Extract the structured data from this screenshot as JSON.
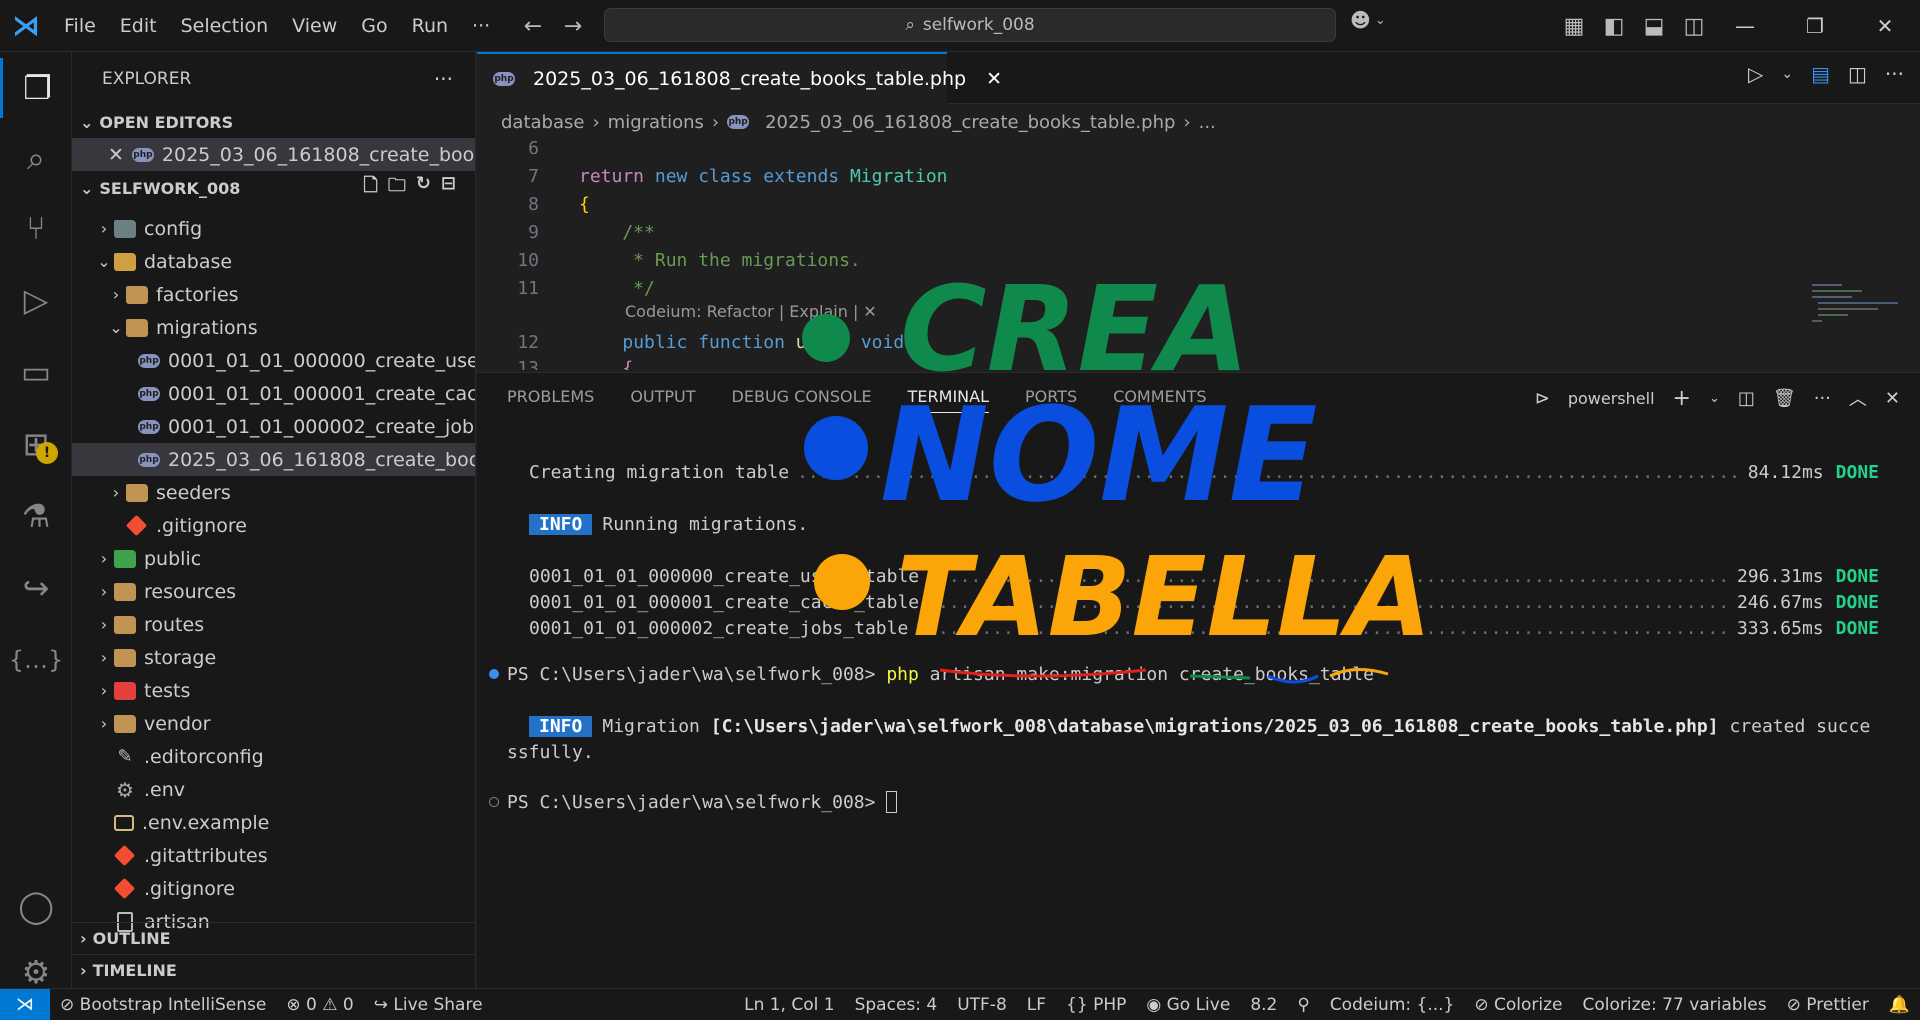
{
  "titlebar": {
    "menus": [
      "File",
      "Edit",
      "Selection",
      "View",
      "Go",
      "Run"
    ],
    "more": "···",
    "search": "selfwork_008"
  },
  "explorer": {
    "header": "EXPLORER",
    "open_editors_label": "OPEN EDITORS",
    "open_editor_file": "2025_03_06_161808_create_books...",
    "project_label": "SELFWORK_008",
    "tree": [
      {
        "label": "config",
        "depth": 1,
        "kind": "folder-config",
        "chev": ">"
      },
      {
        "label": "database",
        "depth": 1,
        "kind": "folder-db",
        "chev": "v"
      },
      {
        "label": "factories",
        "depth": 2,
        "kind": "folder",
        "chev": ">"
      },
      {
        "label": "migrations",
        "depth": 2,
        "kind": "folder",
        "chev": "v"
      },
      {
        "label": "0001_01_01_000000_create_user...",
        "depth": 3,
        "kind": "php",
        "chev": ""
      },
      {
        "label": "0001_01_01_000001_create_cach...",
        "depth": 3,
        "kind": "php",
        "chev": ""
      },
      {
        "label": "0001_01_01_000002_create_jobs...",
        "depth": 3,
        "kind": "php",
        "chev": ""
      },
      {
        "label": "2025_03_06_161808_create_boo...",
        "depth": 3,
        "kind": "php",
        "chev": "",
        "selected": true
      },
      {
        "label": "seeders",
        "depth": 2,
        "kind": "folder",
        "chev": ">"
      },
      {
        "label": ".gitignore",
        "depth": 2,
        "kind": "git",
        "chev": ""
      },
      {
        "label": "public",
        "depth": 1,
        "kind": "folder-green",
        "chev": ">"
      },
      {
        "label": "resources",
        "depth": 1,
        "kind": "folder",
        "chev": ">"
      },
      {
        "label": "routes",
        "depth": 1,
        "kind": "folder",
        "chev": ">"
      },
      {
        "label": "storage",
        "depth": 1,
        "kind": "folder",
        "chev": ">"
      },
      {
        "label": "tests",
        "depth": 1,
        "kind": "folder-red",
        "chev": ">"
      },
      {
        "label": "vendor",
        "depth": 1,
        "kind": "folder",
        "chev": ">"
      },
      {
        "label": ".editorconfig",
        "depth": 1,
        "kind": "editorconfig",
        "chev": ""
      },
      {
        "label": ".env",
        "depth": 1,
        "kind": "gear",
        "chev": ""
      },
      {
        "label": ".env.example",
        "depth": 1,
        "kind": "env",
        "chev": ""
      },
      {
        "label": ".gitattributes",
        "depth": 1,
        "kind": "git",
        "chev": ""
      },
      {
        "label": ".gitignore",
        "depth": 1,
        "kind": "git",
        "chev": ""
      },
      {
        "label": "artisan",
        "depth": 1,
        "kind": "file",
        "chev": ""
      }
    ],
    "outline_label": "OUTLINE",
    "timeline_label": "TIMELINE"
  },
  "editor": {
    "tab_title": "2025_03_06_161808_create_books_table.php",
    "breadcrumb": [
      "database",
      "migrations",
      "2025_03_06_161808_create_books_table.php",
      "..."
    ],
    "codelens": "Codeium: Refactor | Explain | ✕"
  },
  "panel": {
    "tabs": [
      "PROBLEMS",
      "OUTPUT",
      "DEBUG CONSOLE",
      "TERMINAL",
      "PORTS",
      "COMMENTS"
    ],
    "active_tab": "TERMINAL",
    "shell": "powershell",
    "lines": {
      "creating": "Creating migration table",
      "creating_time": "84.12ms",
      "done": "DONE",
      "info": "INFO",
      "running": "Running migrations.",
      "m0": "0001_01_01_000000_create_users_table",
      "m0_time": "296.31ms",
      "m1": "0001_01_01_000001_create_cache_table",
      "m1_time": "246.67ms",
      "m2": "0001_01_01_000002_create_jobs_table",
      "m2_time": "333.65ms",
      "prompt": "PS C:\\Users\\jader\\wa\\selfwork_008>",
      "cmd_php": "php",
      "cmd_rest": "artisan make:migration create_books_table",
      "created_a": "Migration",
      "created_path": "[C:\\Users\\jader\\wa\\selfwork_008\\database\\migrations/2025_03_06_161808_create_books_table.php]",
      "created_b": "created succe",
      "created_c": "ssfully."
    }
  },
  "statusbar": {
    "bootstrap": "Bootstrap IntelliSense",
    "errors": "0",
    "warnings": "0",
    "liveshare": "Live Share",
    "position": "Ln 1, Col 1",
    "spaces": "Spaces: 4",
    "encoding": "UTF-8",
    "eol": "LF",
    "language": "PHP",
    "golive": "Go Live",
    "php_version": "8.2",
    "codeium": "Codeium: {...}",
    "colorize": "Colorize",
    "colorize_vars": "Colorize: 77 variables",
    "prettier": "Prettier"
  },
  "annotations": {
    "word1": "CREA",
    "word2": "NOME",
    "word3": "TABELLA",
    "colors": {
      "green": "#0f8a4c",
      "blue": "#0a4ee0",
      "orange": "#fba508",
      "red": "#e0201a"
    }
  }
}
